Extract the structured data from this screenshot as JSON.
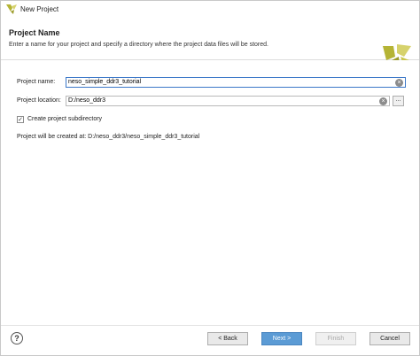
{
  "window": {
    "title": "New Project"
  },
  "header": {
    "title": "Project Name",
    "description": "Enter a name for your project and specify a directory where the project data files will be stored."
  },
  "form": {
    "project_name_label": "Project name:",
    "project_name_value": "neso_simple_ddr3_tutorial",
    "project_location_label": "Project location:",
    "project_location_value": "D:/neso_ddr3",
    "browse_label": "...",
    "create_subdir_label": "Create project subdirectory",
    "create_subdir_checked": true,
    "result_text": "Project will be created at: D:/neso_ddr3/neso_simple_ddr3_tutorial"
  },
  "footer": {
    "help_label": "?",
    "back_label": "< Back",
    "next_label": "Next >",
    "finish_label": "Finish",
    "cancel_label": "Cancel"
  },
  "colors": {
    "logo_olive": "#b5b435",
    "logo_light": "#d6d26c",
    "primary_button": "#5b9bd5"
  },
  "icons": {
    "app_icon": "vivado-logo-icon",
    "clear_icon": "clear-icon",
    "help_icon": "help-icon",
    "check_icon": "check-icon"
  }
}
